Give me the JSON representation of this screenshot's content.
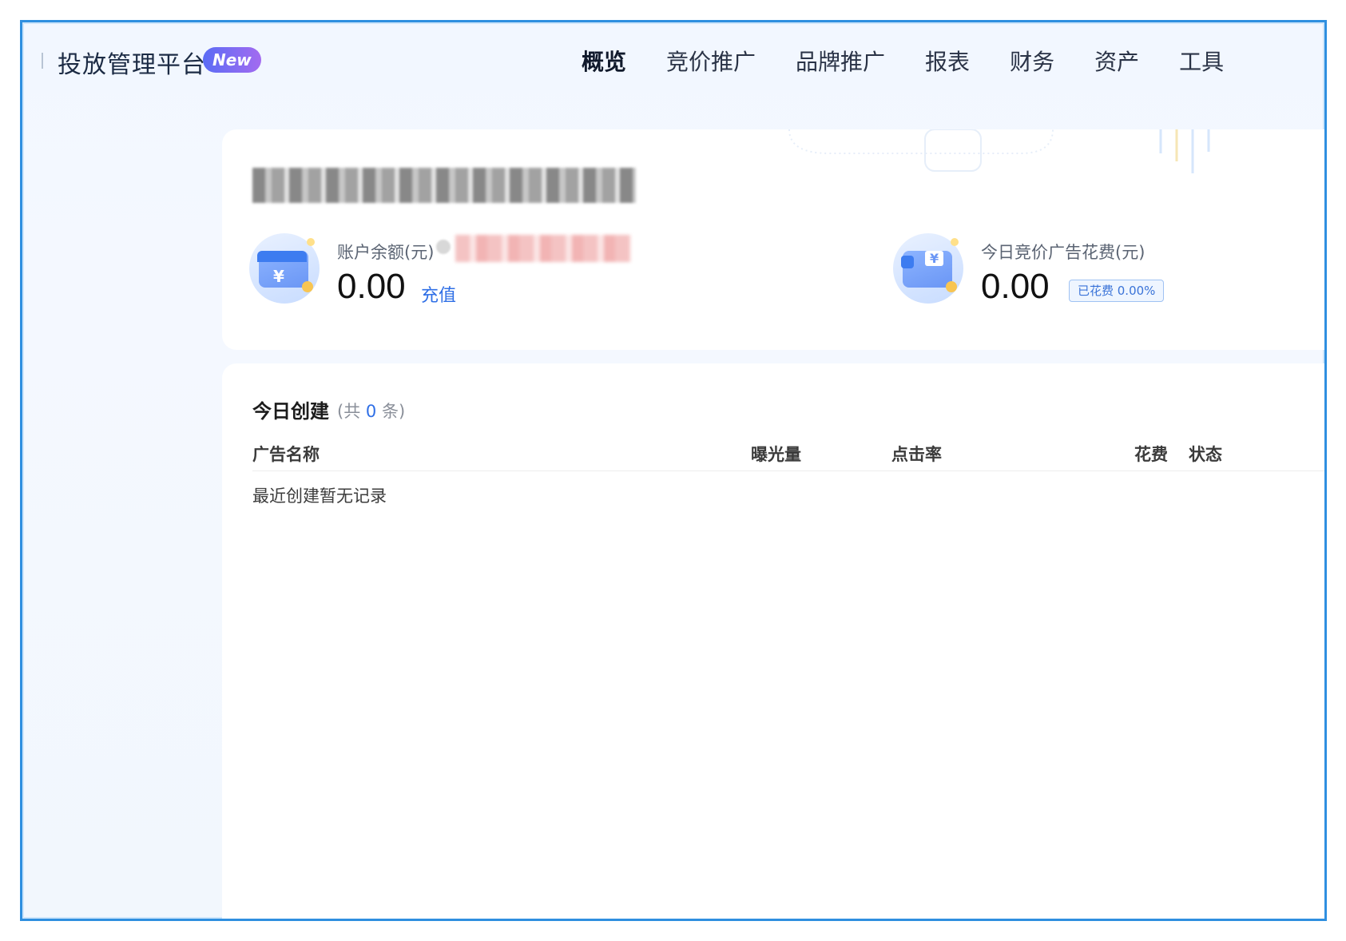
{
  "header": {
    "brand": "投放管理平台",
    "new_badge": "New",
    "nav": [
      "概览",
      "竞价推广",
      "品牌推广",
      "报表",
      "财务",
      "资产",
      "工具"
    ],
    "active_nav": "概览"
  },
  "overview": {
    "balance": {
      "label": "账户余额(元)",
      "value": "0.00",
      "recharge_label": "充值"
    },
    "spend": {
      "label": "今日竞价广告花费(元)",
      "value": "0.00",
      "badge": "已花费 0.00%"
    }
  },
  "today_created": {
    "title": "今日创建",
    "count_prefix": "(共",
    "count": "0",
    "count_suffix": "条)",
    "columns": [
      "广告名称",
      "曝光量",
      "点击率",
      "花费",
      "状态"
    ],
    "empty_text": "最近创建暂无记录"
  },
  "colors": {
    "accent": "#2f6fe6",
    "frame_border": "#2f8fe0",
    "badge_gradient_start": "#5b6cf5",
    "badge_gradient_end": "#a36bf0"
  }
}
